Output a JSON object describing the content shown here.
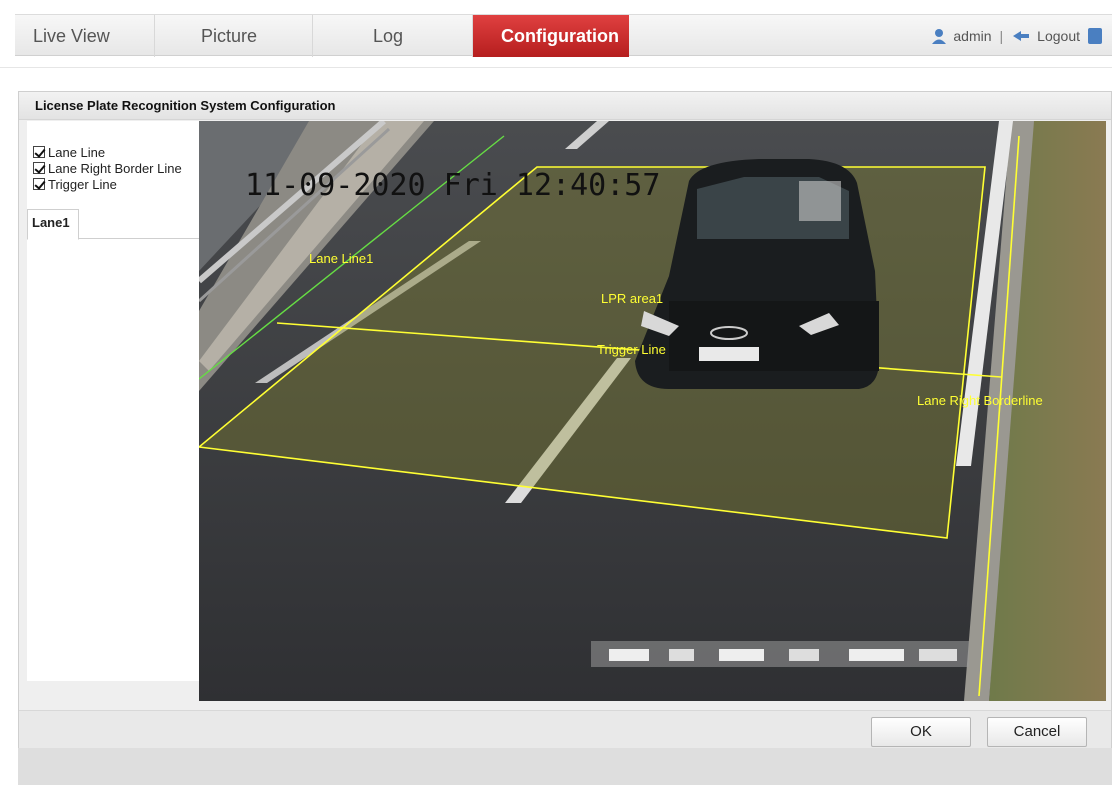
{
  "nav": {
    "tabs": [
      {
        "label": "Live View"
      },
      {
        "label": "Picture"
      },
      {
        "label": "Log"
      },
      {
        "label": "Configuration",
        "active": true
      }
    ],
    "user": "admin",
    "separator": "|",
    "logout": "Logout"
  },
  "dialog": {
    "title": "License Plate Recognition System Configuration",
    "options": [
      {
        "label": "Lane Line",
        "checked": true
      },
      {
        "label": "Lane Right Border Line",
        "checked": true
      },
      {
        "label": "Trigger Line",
        "checked": true
      }
    ],
    "lane_tab": "Lane1",
    "ok": "OK",
    "cancel": "Cancel"
  },
  "video": {
    "timestamp": "11-09-2020 Fri 12:40:57",
    "labels": {
      "lane_line": "Lane Line1",
      "lpr_area": "LPR area1",
      "trigger_line": "Trigger Line",
      "right_border": "Lane Right Borderline"
    }
  },
  "colors": {
    "active_tab": "#c62828",
    "overlay_line": "#ffff33",
    "lane_line": "#66dd44"
  }
}
